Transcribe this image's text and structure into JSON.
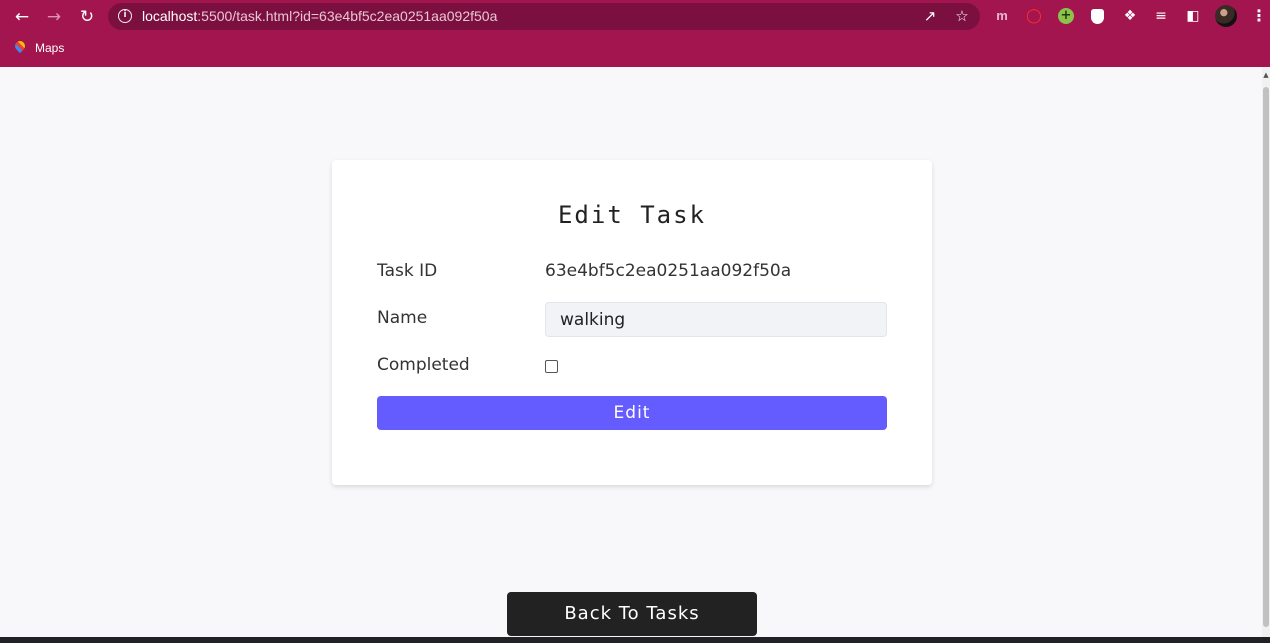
{
  "browser": {
    "url_host": "localhost",
    "url_rest": ":5500/task.html?id=63e4bf5c2ea0251aa092f50a",
    "bookmarks": [
      {
        "label": "Maps"
      }
    ],
    "icons": {
      "back": "arrow-left-icon",
      "forward": "arrow-right-icon",
      "reload": "reload-icon",
      "info": "info-icon",
      "share": "share-icon",
      "star": "star-icon",
      "extensions": "puzzle-icon",
      "reading_list": "reading-list-icon",
      "side_panel": "side-panel-icon",
      "menu": "more-vertical-icon"
    },
    "colors": {
      "frame": "#a3154e",
      "omnibox": "#7b1040"
    }
  },
  "card": {
    "title": "Edit Task",
    "task_id_label": "Task ID",
    "task_id_value": "63e4bf5c2ea0251aa092f50a",
    "name_label": "Name",
    "name_value": "walking",
    "completed_label": "Completed",
    "completed": false,
    "edit_label": "Edit"
  },
  "back_label": "Back To Tasks",
  "colors": {
    "page_bg": "#f8f7f9",
    "accent": "#645cff",
    "back_btn": "#222222"
  }
}
